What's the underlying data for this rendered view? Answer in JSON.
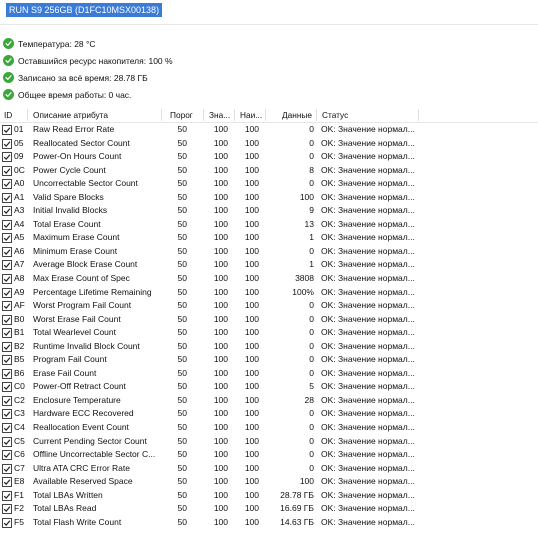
{
  "drive": {
    "title": "RUN S9 256GB (D1FC10MSX00138)"
  },
  "info": [
    {
      "text": "Температура: 28 °C"
    },
    {
      "text": "Оставшийся ресурс накопителя: 100 %"
    },
    {
      "text": "Записано за всё время: 28.78 ГБ"
    },
    {
      "text": "Общее время работы: 0 час."
    }
  ],
  "table": {
    "headers": {
      "id": "ID",
      "desc": "Описание атрибута",
      "threshold": "Порог",
      "value": "Зна...",
      "worst": "Наи...",
      "data": "Данные",
      "status": "Статус"
    },
    "rows": [
      {
        "id": "01",
        "desc": "Raw Read Error Rate",
        "threshold": "50",
        "value": "100",
        "worst": "100",
        "data": "0",
        "status": "OK: Значение нормал..."
      },
      {
        "id": "05",
        "desc": "Reallocated Sector Count",
        "threshold": "50",
        "value": "100",
        "worst": "100",
        "data": "0",
        "status": "OK: Значение нормал..."
      },
      {
        "id": "09",
        "desc": "Power-On Hours Count",
        "threshold": "50",
        "value": "100",
        "worst": "100",
        "data": "0",
        "status": "OK: Значение нормал..."
      },
      {
        "id": "0C",
        "desc": "Power Cycle Count",
        "threshold": "50",
        "value": "100",
        "worst": "100",
        "data": "8",
        "status": "OK: Значение нормал..."
      },
      {
        "id": "A0",
        "desc": "Uncorrectable Sector Count",
        "threshold": "50",
        "value": "100",
        "worst": "100",
        "data": "0",
        "status": "OK: Значение нормал..."
      },
      {
        "id": "A1",
        "desc": "Valid Spare Blocks",
        "threshold": "50",
        "value": "100",
        "worst": "100",
        "data": "100",
        "status": "OK: Значение нормал..."
      },
      {
        "id": "A3",
        "desc": "Initial Invalid Blocks",
        "threshold": "50",
        "value": "100",
        "worst": "100",
        "data": "9",
        "status": "OK: Значение нормал..."
      },
      {
        "id": "A4",
        "desc": "Total Erase Count",
        "threshold": "50",
        "value": "100",
        "worst": "100",
        "data": "13",
        "status": "OK: Значение нормал..."
      },
      {
        "id": "A5",
        "desc": "Maximum Erase Count",
        "threshold": "50",
        "value": "100",
        "worst": "100",
        "data": "1",
        "status": "OK: Значение нормал..."
      },
      {
        "id": "A6",
        "desc": "Minimum Erase Count",
        "threshold": "50",
        "value": "100",
        "worst": "100",
        "data": "0",
        "status": "OK: Значение нормал..."
      },
      {
        "id": "A7",
        "desc": "Average Block Erase Count",
        "threshold": "50",
        "value": "100",
        "worst": "100",
        "data": "1",
        "status": "OK: Значение нормал..."
      },
      {
        "id": "A8",
        "desc": "Max Erase Count of Spec",
        "threshold": "50",
        "value": "100",
        "worst": "100",
        "data": "3808",
        "status": "OK: Значение нормал..."
      },
      {
        "id": "A9",
        "desc": "Percentage Lifetime Remaining",
        "threshold": "50",
        "value": "100",
        "worst": "100",
        "data": "100%",
        "status": "OK: Значение нормал..."
      },
      {
        "id": "AF",
        "desc": "Worst Program Fail Count",
        "threshold": "50",
        "value": "100",
        "worst": "100",
        "data": "0",
        "status": "OK: Значение нормал..."
      },
      {
        "id": "B0",
        "desc": "Worst Erase Fail Count",
        "threshold": "50",
        "value": "100",
        "worst": "100",
        "data": "0",
        "status": "OK: Значение нормал..."
      },
      {
        "id": "B1",
        "desc": "Total Wearlevel Count",
        "threshold": "50",
        "value": "100",
        "worst": "100",
        "data": "0",
        "status": "OK: Значение нормал..."
      },
      {
        "id": "B2",
        "desc": "Runtime Invalid Block Count",
        "threshold": "50",
        "value": "100",
        "worst": "100",
        "data": "0",
        "status": "OK: Значение нормал..."
      },
      {
        "id": "B5",
        "desc": "Program Fail Count",
        "threshold": "50",
        "value": "100",
        "worst": "100",
        "data": "0",
        "status": "OK: Значение нормал..."
      },
      {
        "id": "B6",
        "desc": "Erase Fail Count",
        "threshold": "50",
        "value": "100",
        "worst": "100",
        "data": "0",
        "status": "OK: Значение нормал..."
      },
      {
        "id": "C0",
        "desc": "Power-Off Retract Count",
        "threshold": "50",
        "value": "100",
        "worst": "100",
        "data": "5",
        "status": "OK: Значение нормал..."
      },
      {
        "id": "C2",
        "desc": "Enclosure Temperature",
        "threshold": "50",
        "value": "100",
        "worst": "100",
        "data": "28",
        "status": "OK: Значение нормал..."
      },
      {
        "id": "C3",
        "desc": "Hardware ECC Recovered",
        "threshold": "50",
        "value": "100",
        "worst": "100",
        "data": "0",
        "status": "OK: Значение нормал..."
      },
      {
        "id": "C4",
        "desc": "Reallocation Event Count",
        "threshold": "50",
        "value": "100",
        "worst": "100",
        "data": "0",
        "status": "OK: Значение нормал..."
      },
      {
        "id": "C5",
        "desc": "Current Pending Sector Count",
        "threshold": "50",
        "value": "100",
        "worst": "100",
        "data": "0",
        "status": "OK: Значение нормал..."
      },
      {
        "id": "C6",
        "desc": "Offline Uncorrectable Sector C...",
        "threshold": "50",
        "value": "100",
        "worst": "100",
        "data": "0",
        "status": "OK: Значение нормал..."
      },
      {
        "id": "C7",
        "desc": "Ultra ATA CRC Error Rate",
        "threshold": "50",
        "value": "100",
        "worst": "100",
        "data": "0",
        "status": "OK: Значение нормал..."
      },
      {
        "id": "E8",
        "desc": "Available Reserved Space",
        "threshold": "50",
        "value": "100",
        "worst": "100",
        "data": "100",
        "status": "OK: Значение нормал..."
      },
      {
        "id": "F1",
        "desc": "Total LBAs Written",
        "threshold": "50",
        "value": "100",
        "worst": "100",
        "data": "28.78 ГБ",
        "status": "OK: Значение нормал..."
      },
      {
        "id": "F2",
        "desc": "Total LBAs Read",
        "threshold": "50",
        "value": "100",
        "worst": "100",
        "data": "16.69 ГБ",
        "status": "OK: Значение нормал..."
      },
      {
        "id": "F5",
        "desc": "Total Flash Write Count",
        "threshold": "50",
        "value": "100",
        "worst": "100",
        "data": "14.63 ГБ",
        "status": "OK: Значение нормал..."
      }
    ]
  }
}
